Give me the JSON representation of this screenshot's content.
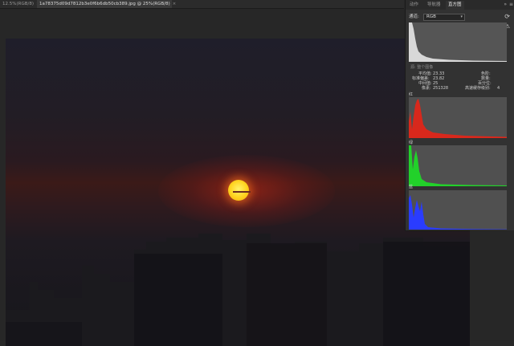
{
  "tabs": [
    {
      "label": "12.5%(RGB/8)",
      "close": "×"
    },
    {
      "label": "1a78375d09d7812b3e0f6b6db50cb389.jpg @ 25%(RGB/8)",
      "close": "×"
    }
  ],
  "panel": {
    "tabs": [
      "动作",
      "导航器",
      "直方图"
    ],
    "active_tab": "直方图",
    "collapse": "»",
    "menu": "≡",
    "channel_label": "通道:",
    "channel_value": "RGB",
    "refresh_icon": "⟳",
    "warning_icon": "⚠",
    "source_label": "源: 整个图像",
    "stats": {
      "mean_label": "平均值:",
      "mean_value": "23.33",
      "std_label": "标准偏差:",
      "std_value": "23.82",
      "median_label": "中间值:",
      "median_value": "25",
      "pixels_label": "像素:",
      "pixels_value": "251328",
      "level_label": "色阶:",
      "count_label": "数量:",
      "percentile_label": "百分位:",
      "cache_label": "高速缓存级别:",
      "cache_value": "4"
    },
    "channels": [
      {
        "label": "红",
        "color": "#e0261a"
      },
      {
        "label": "绿",
        "color": "#22d12a"
      },
      {
        "label": "蓝",
        "color": "#2a3cff"
      }
    ]
  },
  "colors": {
    "main_histogram": "#d8d8d8",
    "panel_bg": "#323232",
    "histogram_bg": "#505050"
  }
}
